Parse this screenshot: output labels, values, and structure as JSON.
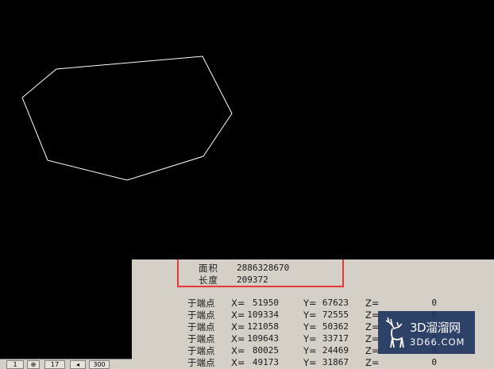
{
  "colors": {
    "canvas_background": "#000000",
    "drawing_line": "#ffffff",
    "text_window_background": "#d4d0c8",
    "highlight_border": "#e8363b",
    "watermark_background": "#20355f"
  },
  "drawing": {
    "shape": "polygon",
    "vertex_count": 8
  },
  "text_window": {
    "summary": {
      "area_label": "面积",
      "area_value": "2886328670",
      "length_label": "长度",
      "length_value": "209372"
    },
    "points": [
      {
        "label": "于端点",
        "x_key": "X=",
        "x": "51950",
        "y_key": "Y=",
        "y": "67623",
        "z_key": "Z=",
        "z": "0"
      },
      {
        "label": "于端点",
        "x_key": "X=",
        "x": "109334",
        "y_key": "Y=",
        "y": "72555",
        "z_key": "Z=",
        "z": "0"
      },
      {
        "label": "于端点",
        "x_key": "X=",
        "x": "121058",
        "y_key": "Y=",
        "y": "50362",
        "z_key": "Z=",
        "z": "0"
      },
      {
        "label": "于端点",
        "x_key": "X=",
        "x": "109643",
        "y_key": "Y=",
        "y": "33717",
        "z_key": "Z=",
        "z": "0"
      },
      {
        "label": "于端点",
        "x_key": "X=",
        "x": "80025",
        "y_key": "Y=",
        "y": "24469",
        "z_key": "Z=",
        "z": "0"
      },
      {
        "label": "于端点",
        "x_key": "X=",
        "x": "49173",
        "y_key": "Y=",
        "y": "31867",
        "z_key": "Z=",
        "z": "0"
      }
    ]
  },
  "watermark": {
    "title": "3D溜溜网",
    "subtitle": "3D66.COM"
  },
  "status_bar": {
    "items": [
      "1",
      "17",
      "300"
    ]
  }
}
